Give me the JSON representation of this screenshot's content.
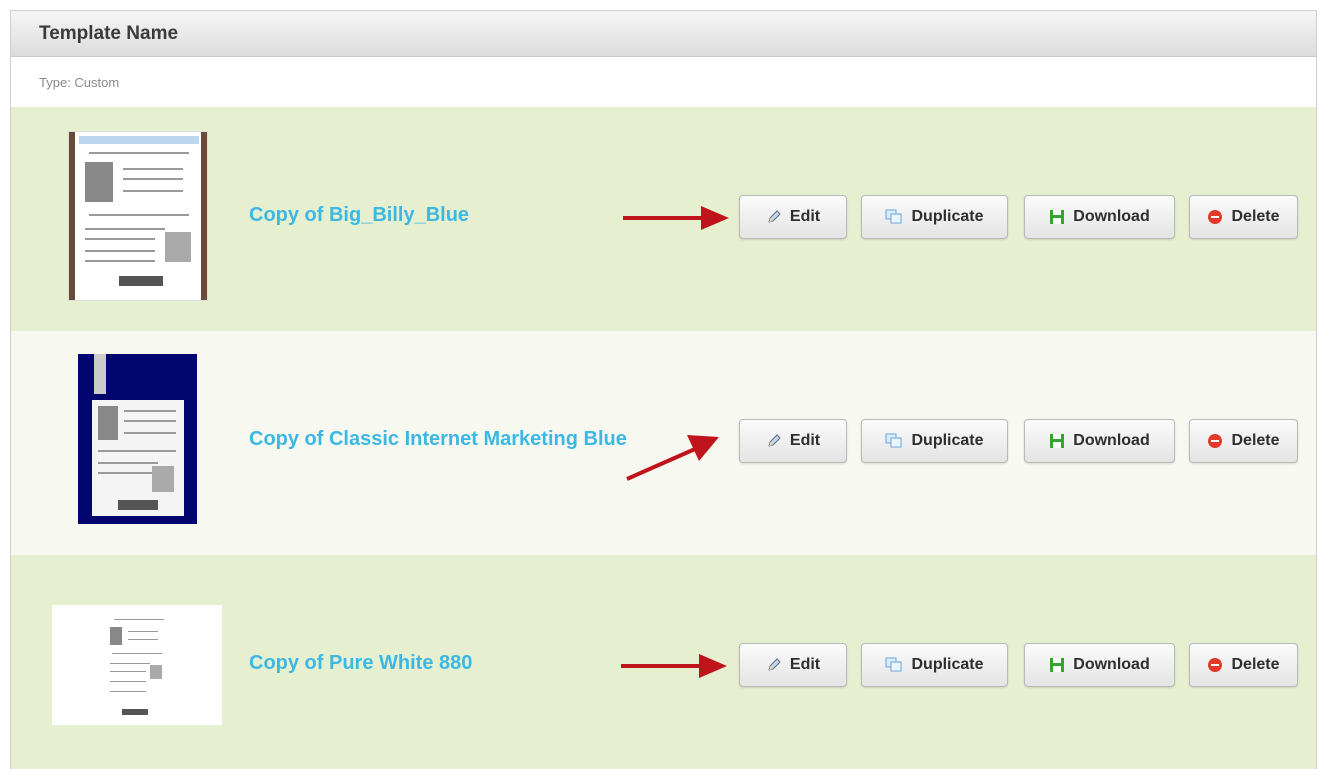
{
  "header": {
    "title": "Template Name"
  },
  "type_label": "Type: Custom",
  "templates": [
    {
      "name": "Copy of Big_Billy_Blue",
      "buttons": {
        "edit": "Edit",
        "duplicate": "Duplicate",
        "download": "Download",
        "delete": "Delete"
      }
    },
    {
      "name": "Copy of Classic Internet Marketing Blue",
      "buttons": {
        "edit": "Edit",
        "duplicate": "Duplicate",
        "download": "Download",
        "delete": "Delete"
      }
    },
    {
      "name": "Copy of Pure White 880",
      "buttons": {
        "edit": "Edit",
        "duplicate": "Duplicate",
        "download": "Download",
        "delete": "Delete"
      }
    }
  ],
  "icons": {
    "edit": "pencil-icon",
    "duplicate": "duplicate-icon",
    "download": "floppy-disk-icon",
    "delete": "minus-circle-icon",
    "arrow": "red-arrow-icon"
  },
  "colors": {
    "link": "#3cb8e4",
    "row_highlight": "#e6efcf",
    "row_alt": "#f7f8ef",
    "arrow": "#c0141c",
    "download_icon": "#3aa22e",
    "delete_icon": "#e23a2a"
  }
}
